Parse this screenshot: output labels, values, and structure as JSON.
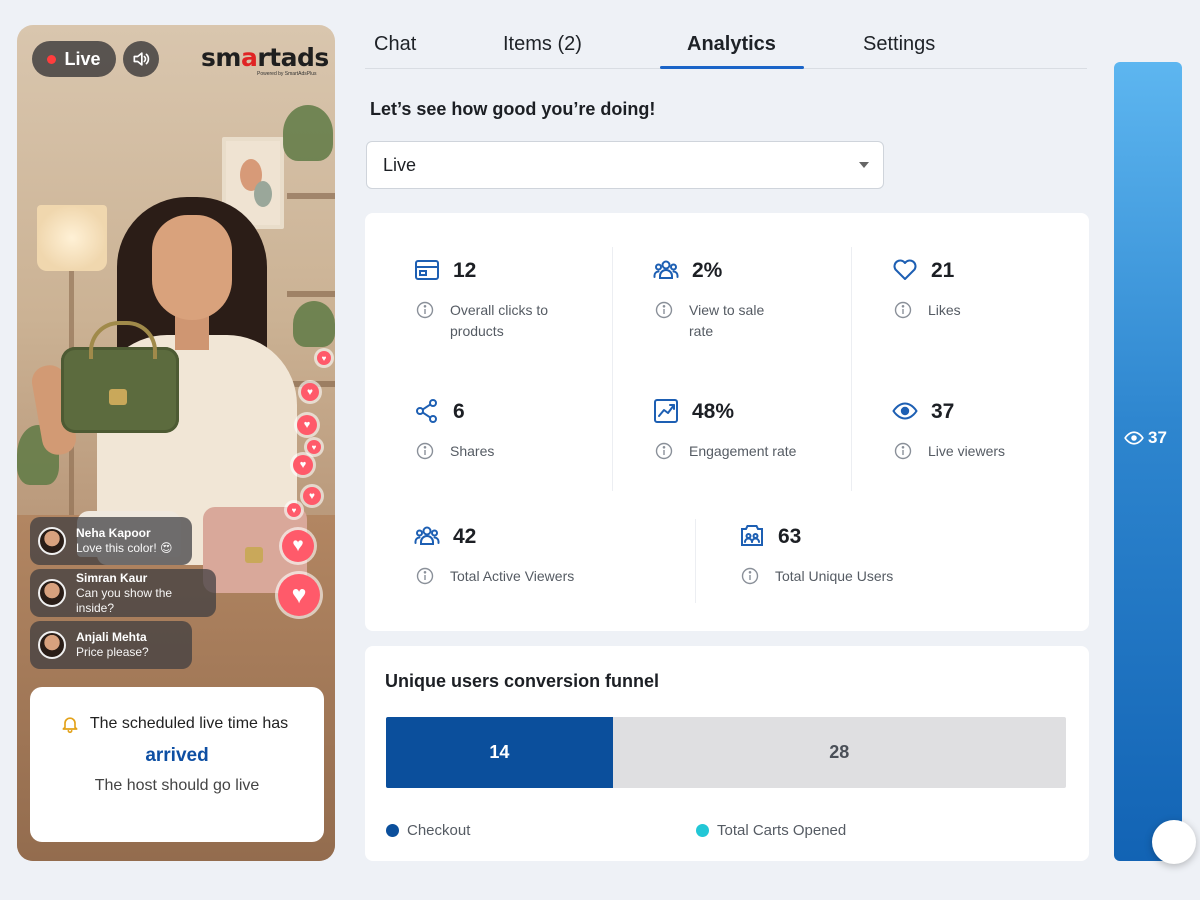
{
  "stream": {
    "live_label": "Live",
    "brand": {
      "prefix": "sm",
      "accent": "a",
      "suffix": "rtads",
      "sub": "Powered by SmartAdsPlus"
    },
    "comments": [
      {
        "name": "Neha Kapoor",
        "text": "Love this color! 😍"
      },
      {
        "name": "Simran Kaur",
        "text": "Can you show the inside?"
      },
      {
        "name": "Anjali Mehta",
        "text": "Price please?"
      }
    ],
    "notice": {
      "line1": "The scheduled live time has",
      "line2": "arrived",
      "line3": "The host should go live"
    }
  },
  "tabs": [
    {
      "label": "Chat"
    },
    {
      "label": "Items (2)"
    },
    {
      "label": "Analytics",
      "active": true
    },
    {
      "label": "Settings"
    }
  ],
  "headline": "Let’s see how good you’re doing!",
  "filter": {
    "selected": "Live"
  },
  "stats": [
    {
      "icon": "product-card-icon",
      "value": "12",
      "label": "Overall clicks to products"
    },
    {
      "icon": "users-icon",
      "value": "2%",
      "label": "View to sale rate"
    },
    {
      "icon": "heart-icon",
      "value": "21",
      "label": "Likes"
    },
    {
      "icon": "share-icon",
      "value": "6",
      "label": "Shares"
    },
    {
      "icon": "trend-chart-icon",
      "value": "48%",
      "label": "Engagement rate"
    },
    {
      "icon": "eye-icon",
      "value": "37",
      "label": "Live viewers"
    },
    {
      "icon": "users-icon",
      "value": "42",
      "label": "Total Active Viewers"
    },
    {
      "icon": "unique-users-icon",
      "value": "63",
      "label": "Total Unique Users"
    }
  ],
  "funnel": {
    "title": "Unique users conversion funnel",
    "segments": [
      {
        "label": "14",
        "value": 14
      },
      {
        "label": "28",
        "value": 28
      }
    ],
    "legend": [
      {
        "label": "Checkout"
      },
      {
        "label": "Total Carts Opened"
      }
    ]
  },
  "rail": {
    "viewers": "37"
  },
  "colors": {
    "accent": "#1a64c8",
    "checkout": "#0b4f9c",
    "carts_opened": "#22c7d6",
    "icon_blue": "#1d5fb3",
    "brand_red": "#e02424",
    "heart": "#ff5a6a"
  }
}
